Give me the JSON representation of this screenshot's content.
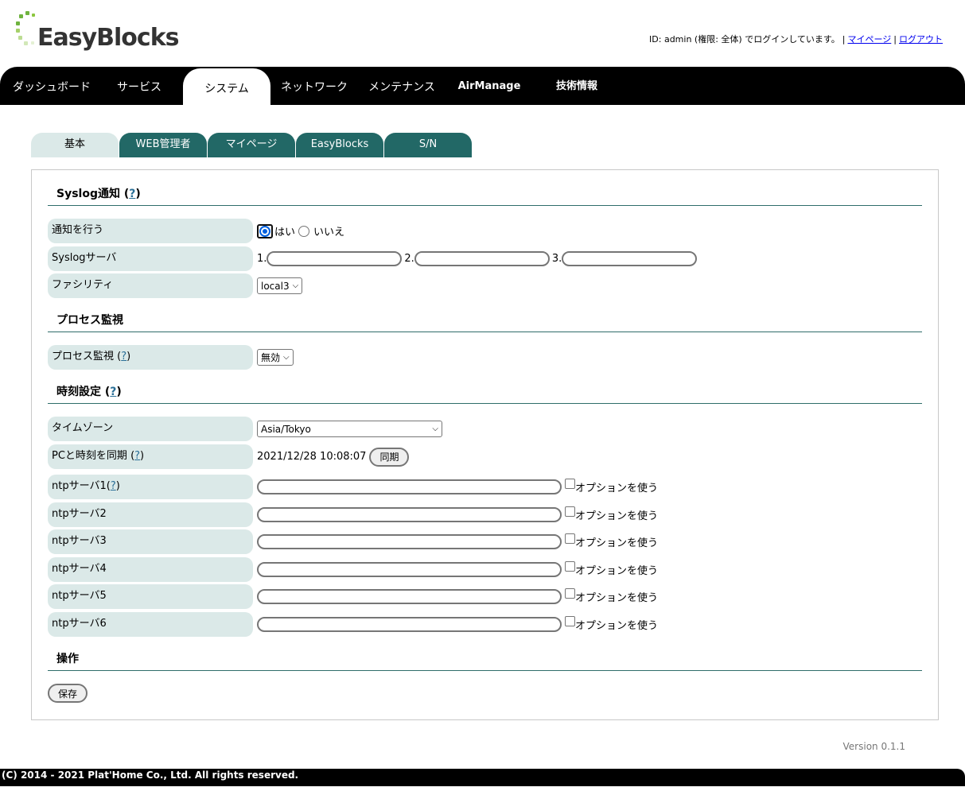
{
  "header": {
    "logo_text": "EasyBlocks",
    "login_prefix": "ID: admin (権限: 全体) でログインしています。",
    "sep1": "|",
    "mypage_link": "マイページ",
    "sep2": "|",
    "logout_link": "ログアウト"
  },
  "mainnav": {
    "items": [
      "ダッシュボード",
      "サービス",
      "システム",
      "ネットワーク",
      "メンテナンス",
      "AirManage",
      "技術情報"
    ],
    "active_index": 2
  },
  "subtabs": {
    "items": [
      "基本",
      "WEB管理者",
      "マイページ",
      "EasyBlocks",
      "S/N"
    ],
    "active_index": 0
  },
  "syslog": {
    "title": "Syslog通知",
    "help_open": "(",
    "help": "?",
    "help_close": ")",
    "notify_label": "通知を行う",
    "radio_yes": "はい",
    "radio_no": "いいえ",
    "notify_value": "はい",
    "server_label": "Syslogサーバ",
    "server_prefixes": [
      "1.",
      "2.",
      "3."
    ],
    "servers": [
      "",
      "",
      ""
    ],
    "facility_label": "ファシリティ",
    "facility_value": "local3"
  },
  "process": {
    "title": "プロセス監視",
    "label": "プロセス監視",
    "help_open": "(",
    "help": "?",
    "help_close": ")",
    "value": "無効"
  },
  "time": {
    "title": "時刻設定",
    "help_open": "(",
    "help": "?",
    "help_close": ")",
    "timezone_label": "タイムゾーン",
    "timezone_value": "Asia/Tokyo",
    "sync_label": "PCと時刻を同期",
    "sync_datetime": "2021/12/28 10:08:07",
    "sync_button": "同期",
    "ntp_option_label": "オプションを使う",
    "ntp_servers": [
      {
        "label": "ntpサーバ1",
        "value": "",
        "option": false
      },
      {
        "label": "ntpサーバ2",
        "value": "",
        "option": false
      },
      {
        "label": "ntpサーバ3",
        "value": "",
        "option": false
      },
      {
        "label": "ntpサーバ4",
        "value": "",
        "option": false
      },
      {
        "label": "ntpサーバ5",
        "value": "",
        "option": false
      },
      {
        "label": "ntpサーバ6",
        "value": "",
        "option": false
      }
    ]
  },
  "operation": {
    "title": "操作",
    "save_button": "保存"
  },
  "version": "Version 0.1.1",
  "footer": "(C) 2014 - 2021 Plat'Home Co., Ltd. All rights reserved.",
  "colors": {
    "tab_active": "#dbe9e8",
    "tab_inactive": "#226866",
    "section_rule": "#2f6d6a",
    "help_link": "#2a6f97"
  }
}
